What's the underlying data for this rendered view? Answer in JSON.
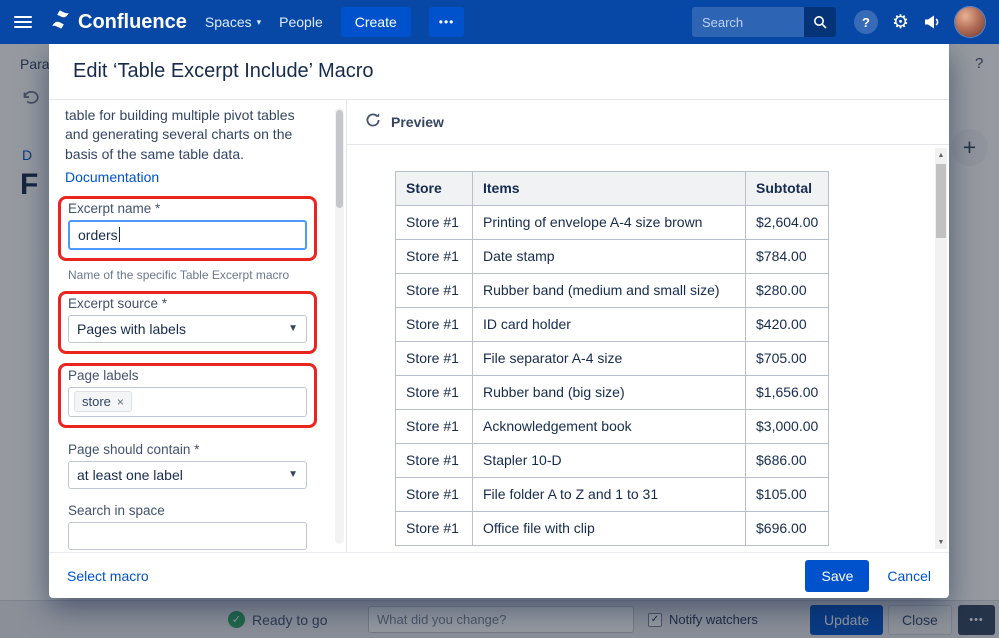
{
  "navbar": {
    "brand": "Confluence",
    "menu": [
      {
        "label": "Spaces"
      },
      {
        "label": "People"
      }
    ],
    "create_label": "Create",
    "more_label": "•••",
    "search_placeholder": "Search"
  },
  "background": {
    "toolbar_text": "Para",
    "help_icon_label": "?",
    "breadcrumb_letter": "D",
    "page_title_letter": "F",
    "plus_label": "+"
  },
  "modal": {
    "title": "Edit ‘Table Excerpt Include’ Macro",
    "description": "table for building multiple pivot tables and generating several charts on the basis of the same table data.",
    "documentation_label": "Documentation",
    "fields": {
      "excerpt_name_label": "Excerpt name *",
      "excerpt_name_value": "orders",
      "excerpt_name_help": "Name of the specific Table Excerpt macro",
      "excerpt_source_label": "Excerpt source *",
      "excerpt_source_value": "Pages with labels",
      "page_labels_label": "Page labels",
      "page_label_tag": "store",
      "tag_remove": "×",
      "page_contain_label": "Page should contain *",
      "page_contain_value": "at least one label",
      "search_space_label": "Search in space"
    },
    "preview_title": "Preview",
    "select_macro_label": "Select macro",
    "save_label": "Save",
    "cancel_label": "Cancel"
  },
  "preview_table": {
    "columns": [
      "Store",
      "Items",
      "Subtotal"
    ],
    "rows": [
      [
        "Store #1",
        "Printing of envelope A-4 size brown",
        "$2,604.00"
      ],
      [
        "Store #1",
        "Date stamp",
        "$784.00"
      ],
      [
        "Store #1",
        "Rubber band (medium and small size)",
        "$280.00"
      ],
      [
        "Store #1",
        "ID card holder",
        "$420.00"
      ],
      [
        "Store #1",
        "File separator A-4 size",
        "$705.00"
      ],
      [
        "Store #1",
        "Rubber band (big size)",
        "$1,656.00"
      ],
      [
        "Store #1",
        "Acknowledgement book",
        "$3,000.00"
      ],
      [
        "Store #1",
        "Stapler 10-D",
        "$686.00"
      ],
      [
        "Store #1",
        "File folder A to Z and 1 to 31",
        "$105.00"
      ],
      [
        "Store #1",
        "Office file with clip",
        "$696.00"
      ]
    ]
  },
  "statusbar": {
    "ready_label": "Ready to go",
    "change_placeholder": "What did you change?",
    "notify_label": "Notify watchers",
    "update_label": "Update",
    "close_label": "Close",
    "more_label": "•••"
  },
  "icons": {
    "dropdown_arrow": "▼",
    "chevron_down": "▾",
    "scroll_up": "▲",
    "scroll_down": "▼",
    "check": "✓",
    "gear": "⚙",
    "question": "?"
  },
  "colors": {
    "navbar": "#0747a6",
    "accent": "#0052cc",
    "highlight_red": "#e8261d",
    "focus_blue": "#4c9aff",
    "ready_green": "#28a463"
  }
}
